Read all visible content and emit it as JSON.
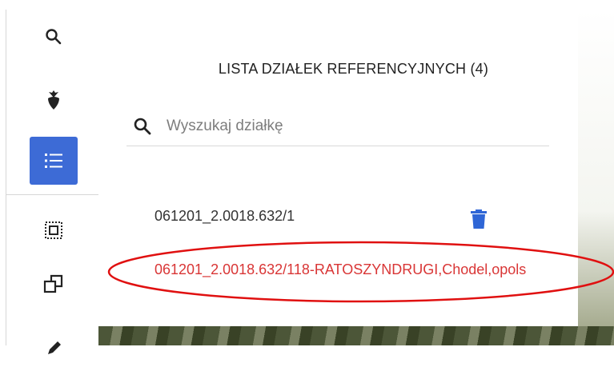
{
  "sidebar": {
    "items": [
      {
        "name": "search",
        "icon": "search-icon"
      },
      {
        "name": "crops",
        "icon": "beet-icon"
      },
      {
        "name": "list",
        "icon": "list-icon",
        "active": true
      },
      {
        "name": "select-area",
        "icon": "select-box-icon"
      },
      {
        "name": "copy",
        "icon": "copy-icon"
      },
      {
        "name": "edit",
        "icon": "pencil-icon"
      }
    ]
  },
  "panel": {
    "title": "LISTA DZIAŁEK REFERENCYJNYCH (4)",
    "search": {
      "placeholder": "Wyszukaj działkę",
      "value": ""
    },
    "parcels": [
      {
        "label": "061201_2.0018.632/1",
        "color": "#333333"
      },
      {
        "label": "061201_2.0018.632/118-RATOSZYNDRUGI,Chodel,opols",
        "color": "#d93636"
      }
    ]
  },
  "colors": {
    "accent": "#3d6bd6",
    "highlight": "#d93636",
    "annotation": "#e01010"
  }
}
